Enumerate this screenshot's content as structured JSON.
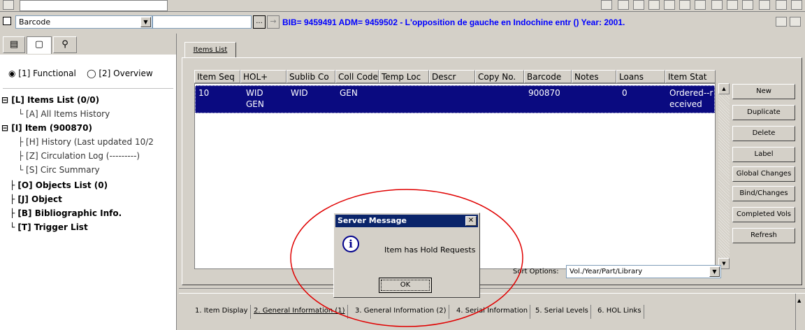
{
  "toolbar": {
    "search_type": "Barcode",
    "search_value": "",
    "record_title": "BIB= 9459491 ADM= 9459502 - L'opposition de gauche en Indochine entr () Year: 2001.",
    "ellipsis_label": "..."
  },
  "left_panel": {
    "view_options": [
      "[1] Functional",
      "[2] Overview"
    ],
    "tree": [
      {
        "label": "[L] Items List (0/0)",
        "bold": true
      },
      {
        "label": "[A] All Items History",
        "bold": false
      },
      {
        "label": "[I] Item (900870)",
        "bold": true
      },
      {
        "label": "[H] History (Last updated 10/2",
        "bold": false
      },
      {
        "label": "[Z] Circulation Log (---------)",
        "bold": false
      },
      {
        "label": "[S] Circ Summary",
        "bold": false
      },
      {
        "label": "[O] Objects List (0)",
        "bold": true
      },
      {
        "label": "[J] Object",
        "bold": true
      },
      {
        "label": "[B] Bibliographic Info.",
        "bold": true
      },
      {
        "label": "[T] Trigger List",
        "bold": true
      }
    ]
  },
  "items_tab": "Items List",
  "table": {
    "columns": [
      "Item Seq",
      "HOL+",
      "Sublib Co",
      "Coll Code",
      "Temp Loc",
      "Descr",
      "Copy No.",
      "Barcode",
      "Notes",
      "Loans",
      "Item Stat"
    ],
    "row": {
      "item_seq": "10",
      "hol_line1": "WID",
      "hol_line2": "GEN",
      "sublib": "WID",
      "coll_code": "GEN",
      "barcode": "900870",
      "loans": "0",
      "item_stat_line1": "Ordered--r",
      "item_stat_line2": "eceived"
    }
  },
  "buttons": [
    "New",
    "Duplicate",
    "Delete",
    "Label",
    "Global Changes",
    "Bind/Changes",
    "Completed Vols",
    "Refresh"
  ],
  "sort": {
    "label": "Sort Options:",
    "value": "Vol./Year/Part/Library"
  },
  "dialog": {
    "title": "Server Message",
    "message": "Item has Hold Requests",
    "ok_label": "OK",
    "close_glyph": "✕",
    "info_glyph": "i"
  },
  "bottom_tabs": [
    "1. Item Display",
    "2. General Information (1)",
    "3. General Information (2)",
    "4. Serial Information",
    "5. Serial Levels",
    "6. HOL Links"
  ],
  "colors": {
    "selection": "#0a0a80",
    "title_blue": "#0000ff",
    "dialog_title": "#0a246a",
    "annotation_red": "#e00000"
  }
}
